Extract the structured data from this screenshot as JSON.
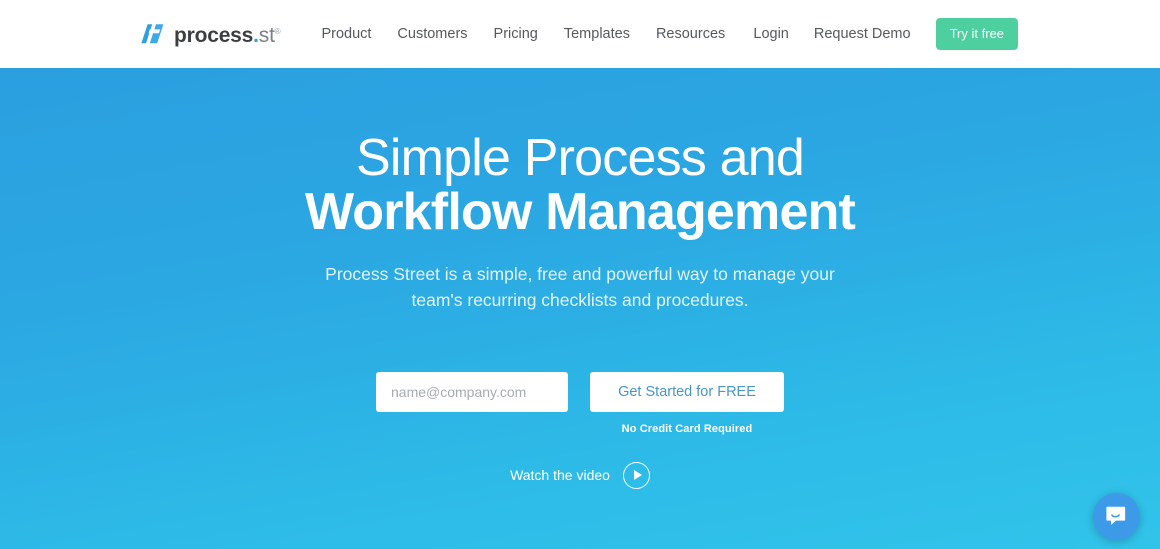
{
  "header": {
    "logo": {
      "mark_icon": "process-st-logo-icon",
      "word_primary": "process",
      "dot": ".",
      "word_secondary": "st",
      "registered": "®",
      "mark_color": "#2e9fe0"
    },
    "nav": [
      {
        "label": "Product",
        "name": "nav-link-product"
      },
      {
        "label": "Customers",
        "name": "nav-link-customers"
      },
      {
        "label": "Pricing",
        "name": "nav-link-pricing"
      },
      {
        "label": "Templates",
        "name": "nav-link-templates"
      },
      {
        "label": "Resources",
        "name": "nav-link-resources"
      }
    ],
    "login_label": "Login",
    "request_demo_label": "Request Demo",
    "try_free_label": "Try it free",
    "try_free_color": "#4ecfa0"
  },
  "hero": {
    "title_line1": "Simple Process and",
    "title_line2": "Workflow Management",
    "sub_line1": "Process Street is a simple, free and powerful way to manage your",
    "sub_line2": "team's recurring checklists and procedures.",
    "email_placeholder": "name@company.com",
    "email_value": "",
    "cta_label": "Get Started for FREE",
    "no_credit_card": "No Credit Card Required",
    "watch_video_label": "Watch the video",
    "play_icon": "play-icon",
    "gradient_top": "#2b9fe0",
    "gradient_bottom": "#31c4ea",
    "cta_text_color": "#4a96c9"
  },
  "chat": {
    "icon": "chat-bubble-icon",
    "background": "#3d9ae8"
  }
}
